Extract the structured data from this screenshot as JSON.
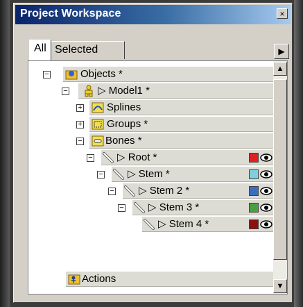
{
  "window": {
    "title": "Project Workspace",
    "close_label": "×"
  },
  "tabs": [
    {
      "label": "All"
    },
    {
      "label": "Selected"
    }
  ],
  "tab_scroll_label": "▶",
  "tree": [
    {
      "label": "Objects *"
    },
    {
      "label": "▷ Model1 *"
    },
    {
      "label": "Splines"
    },
    {
      "label": "Groups *"
    },
    {
      "label": "Bones *"
    },
    {
      "label": "▷ Root *",
      "color": "#e02020"
    },
    {
      "label": "▷ Stem *",
      "color": "#7fd0dc"
    },
    {
      "label": "▷ Stem 2 *",
      "color": "#3a6fc0"
    },
    {
      "label": "▷ Stem 3 *",
      "color": "#4aa040"
    },
    {
      "label": "▷ Stem 4 *",
      "color": "#8b1010"
    },
    {
      "label": "Actions"
    }
  ],
  "scroll": {
    "up": "▲",
    "down": "▼"
  }
}
